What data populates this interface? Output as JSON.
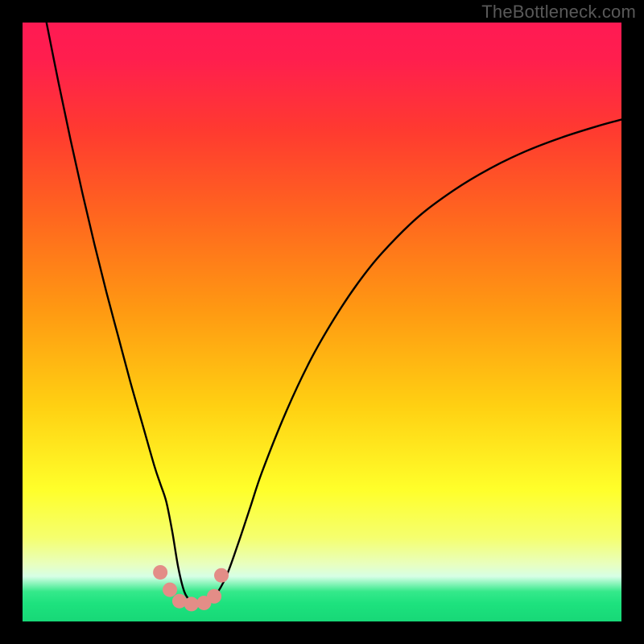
{
  "watermark": "TheBottleneck.com",
  "chart_data": {
    "type": "line",
    "title": "",
    "xlabel": "",
    "ylabel": "",
    "xlim": [
      0,
      100
    ],
    "ylim": [
      0,
      100
    ],
    "grid": false,
    "legend": false,
    "gradient_stops": [
      {
        "offset": 0.0,
        "color": "#ff1a53"
      },
      {
        "offset": 0.06,
        "color": "#ff1e4e"
      },
      {
        "offset": 0.18,
        "color": "#ff3a30"
      },
      {
        "offset": 0.32,
        "color": "#ff651f"
      },
      {
        "offset": 0.48,
        "color": "#ff9912"
      },
      {
        "offset": 0.64,
        "color": "#ffd012"
      },
      {
        "offset": 0.78,
        "color": "#ffff2a"
      },
      {
        "offset": 0.86,
        "color": "#f5ff6e"
      },
      {
        "offset": 0.905,
        "color": "#e8ffc0"
      },
      {
        "offset": 0.925,
        "color": "#d6ffe6"
      },
      {
        "offset": 0.95,
        "color": "#35e98b"
      },
      {
        "offset": 0.97,
        "color": "#1de27e"
      },
      {
        "offset": 1.0,
        "color": "#17d877"
      }
    ],
    "series": [
      {
        "name": "bottleneck-curve",
        "x": [
          4,
          6,
          8,
          10,
          12,
          14,
          16,
          18,
          20,
          22,
          23,
          24,
          25,
          26,
          27,
          28,
          29,
          30,
          31,
          32,
          34,
          36,
          38,
          40,
          44,
          48,
          52,
          56,
          60,
          66,
          72,
          78,
          84,
          90,
          96,
          100
        ],
        "y": [
          100,
          90,
          80.5,
          71.5,
          63,
          55,
          47.5,
          40,
          33,
          26,
          23,
          20,
          15,
          9,
          5,
          3.5,
          3,
          3,
          3.3,
          4,
          7.5,
          13,
          19,
          25,
          35,
          43.5,
          50.5,
          56.5,
          61.5,
          67.5,
          72,
          75.6,
          78.5,
          80.8,
          82.7,
          83.8
        ]
      }
    ],
    "markers": {
      "name": "highlight-dots",
      "color": "#e38d87",
      "radius_px": 9,
      "points": [
        {
          "x": 23.0,
          "y": 8.2
        },
        {
          "x": 24.6,
          "y": 5.3
        },
        {
          "x": 26.2,
          "y": 3.4
        },
        {
          "x": 28.2,
          "y": 2.9
        },
        {
          "x": 30.3,
          "y": 3.1
        },
        {
          "x": 32.0,
          "y": 4.2
        },
        {
          "x": 33.2,
          "y": 7.7
        }
      ]
    }
  }
}
